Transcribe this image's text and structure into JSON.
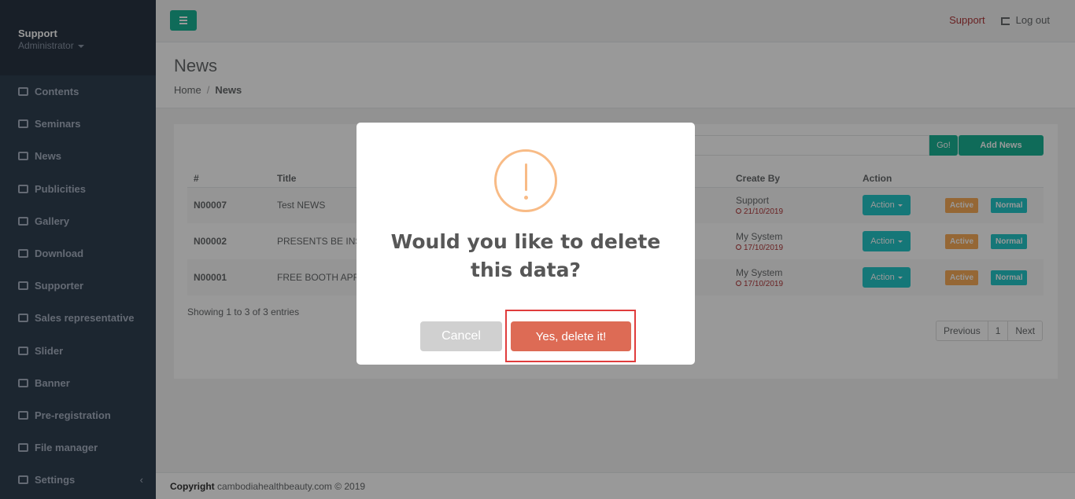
{
  "sidebar": {
    "profile": {
      "name": "Support",
      "role": "Administrator"
    },
    "items": [
      {
        "label": "Contents",
        "icon": "list-icon"
      },
      {
        "label": "Seminars",
        "icon": "calendar-icon"
      },
      {
        "label": "News",
        "icon": "newspaper-icon"
      },
      {
        "label": "Publicities",
        "icon": "document-icon"
      },
      {
        "label": "Gallery",
        "icon": "image-icon"
      },
      {
        "label": "Download",
        "icon": "download-icon"
      },
      {
        "label": "Supporter",
        "icon": "users-icon"
      },
      {
        "label": "Sales representative",
        "icon": "bookmark-icon"
      },
      {
        "label": "Slider",
        "icon": "shuffle-icon"
      },
      {
        "label": "Banner",
        "icon": "picture-icon"
      },
      {
        "label": "Pre-registration",
        "icon": "list-icon"
      },
      {
        "label": "File manager",
        "icon": "cloud-icon"
      },
      {
        "label": "Settings",
        "icon": "gears-icon",
        "chevron": "‹"
      }
    ]
  },
  "topbar": {
    "support_link": "Support",
    "logout_label": "Log out"
  },
  "page": {
    "title": "News",
    "breadcrumb": {
      "home": "Home",
      "separator": "/",
      "current": "News"
    }
  },
  "toolbar": {
    "go_label": "Go!",
    "add_label": "Add News"
  },
  "table": {
    "headers": {
      "id": "#",
      "title": "Title",
      "create_by": "Create By",
      "action": "Action"
    },
    "rows": [
      {
        "id": "N00007",
        "title": "Test NEWS",
        "creator": "Support",
        "date": "21/10/2019",
        "action": "Action",
        "status": "Active",
        "type": "Normal"
      },
      {
        "id": "N00002",
        "title": "PRESENTS BE INS",
        "creator": "My System",
        "date": "17/10/2019",
        "action": "Action",
        "status": "Active",
        "type": "Normal"
      },
      {
        "id": "N00001",
        "title": "FREE BOOTH APF",
        "creator": "My System",
        "date": "17/10/2019",
        "action": "Action",
        "status": "Active",
        "type": "Normal"
      }
    ]
  },
  "showing": "Showing 1 to 3 of 3 entries",
  "pagination": {
    "previous": "Previous",
    "page": "1",
    "next": "Next"
  },
  "footer": {
    "copyright_label": "Copyright",
    "text": " cambodiahealthbeauty.com © 2019"
  },
  "dialog": {
    "title": "Would you like to delete this data?",
    "cancel_label": "Cancel",
    "confirm_label": "Yes, delete it!"
  },
  "colors": {
    "sidebar": "#2f4050",
    "primary": "#1ab394",
    "warning": "#f8bb86",
    "confirm": "#dd6b55",
    "highlight": "#e03c3c"
  }
}
